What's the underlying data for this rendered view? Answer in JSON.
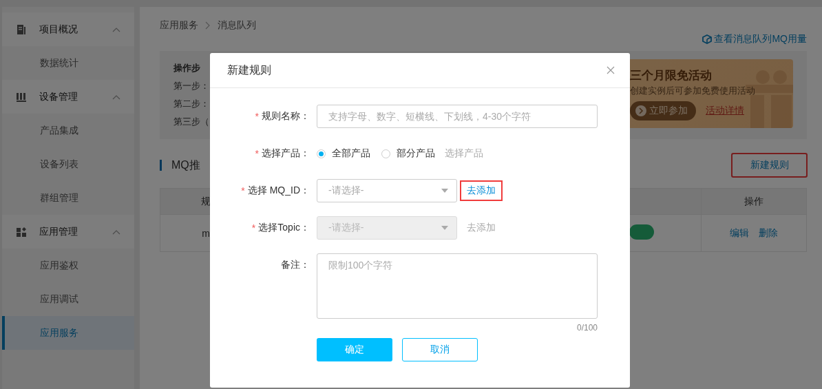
{
  "sidebar": {
    "groups": [
      {
        "label": "项目概况",
        "expanded": true,
        "items": [
          {
            "label": "数据统计",
            "selected": false
          }
        ]
      },
      {
        "label": "设备管理",
        "expanded": true,
        "items": [
          {
            "label": "产品集成",
            "selected": false
          },
          {
            "label": "设备列表",
            "selected": false
          },
          {
            "label": "群组管理",
            "selected": false
          }
        ]
      },
      {
        "label": "应用管理",
        "expanded": true,
        "items": [
          {
            "label": "应用鉴权",
            "selected": false
          },
          {
            "label": "应用调试",
            "selected": false
          },
          {
            "label": "应用服务",
            "selected": true
          }
        ]
      }
    ]
  },
  "breadcrumb": [
    "应用服务",
    "消息队列"
  ],
  "usage_link": "查看消息队列MQ用量",
  "steps": {
    "title": "操作步",
    "lines": [
      "第一步：",
      "第二步：",
      "第三步（"
    ]
  },
  "promo": {
    "title": "三个月限免活动",
    "text": "创建实例后可参加免费使用活动",
    "join": "立即参加",
    "details": "活动详情"
  },
  "section_title": "MQ推",
  "new_rule_button": {
    "label": "新建规则",
    "highlighted": true
  },
  "table": {
    "columns": [
      "规",
      "操作"
    ],
    "rows": [
      {
        "cells": [
          "m"
        ],
        "status_on": true,
        "actions": [
          "编辑",
          "删除"
        ]
      }
    ]
  },
  "dialog": {
    "title": "新建规则",
    "fields": [
      {
        "kind": "text",
        "mark": "*",
        "label": "规则名称：",
        "placeholder": "支持字母、数字、短横线、下划线，4-30个字符"
      },
      {
        "kind": "radio",
        "mark": "*",
        "label": "选择产品：",
        "options": [
          {
            "label": "全部产品",
            "selected": true
          },
          {
            "label": "部分产品",
            "selected": false
          }
        ],
        "link": {
          "label": "选择产品",
          "disabled": true,
          "highlighted": false
        }
      },
      {
        "kind": "select",
        "mark": "*",
        "label": "选择 MQ_ID：",
        "placeholder": "-请选择-",
        "disabled": false,
        "link": {
          "label": "去添加",
          "disabled": false,
          "highlighted": true
        }
      },
      {
        "kind": "select",
        "mark": "*",
        "label": "选择Topic：",
        "placeholder": "-请选择-",
        "disabled": true,
        "link": {
          "label": "去添加",
          "disabled": true,
          "highlighted": false
        }
      },
      {
        "kind": "textarea",
        "label": "备注：",
        "placeholder": "限制100个字符",
        "counter": "0/100"
      }
    ],
    "buttons": {
      "confirm": "确定",
      "cancel": "取消"
    }
  }
}
